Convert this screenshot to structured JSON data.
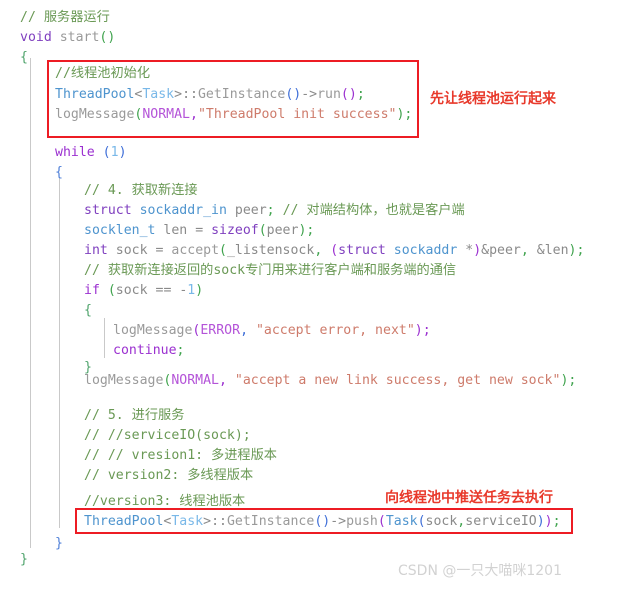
{
  "editor": {
    "language": "cpp",
    "background": "#ffffff",
    "font_size_px": 13.2,
    "line_height_px": 20
  },
  "colors": {
    "comment": "#6A9955",
    "keyword": "#7F3FBF",
    "type": "#4E94CE",
    "string": "#CE7B6B",
    "constant": "#B454D8",
    "number": "#79B8E8",
    "plain": "#8a8a8a",
    "annotation_red": "#E8392B",
    "box_red": "#ED1C24",
    "guide": "#c9c9c9",
    "watermark": "#d2d2d2"
  },
  "code": {
    "lines": [
      {
        "n": 1,
        "indent": 0,
        "text": "// 服务器运行"
      },
      {
        "n": 2,
        "indent": 0,
        "text": "void start()"
      },
      {
        "n": 3,
        "indent": 0,
        "text": "{"
      },
      {
        "n": 4,
        "indent": 1,
        "text": "//线程池初始化"
      },
      {
        "n": 5,
        "indent": 1,
        "text": "ThreadPool<Task>::GetInstance()->run();"
      },
      {
        "n": 6,
        "indent": 1,
        "text": "logMessage(NORMAL,\"ThreadPool init success\");"
      },
      {
        "n": 7,
        "indent": 1,
        "text": "while (1)"
      },
      {
        "n": 8,
        "indent": 1,
        "text": "{"
      },
      {
        "n": 9,
        "indent": 2,
        "text": "// 4. 获取新连接"
      },
      {
        "n": 10,
        "indent": 2,
        "text": "struct sockaddr_in peer; // 对端结构体，也就是客户端"
      },
      {
        "n": 11,
        "indent": 2,
        "text": "socklen_t len = sizeof(peer);"
      },
      {
        "n": 12,
        "indent": 2,
        "text": "int sock = accept(_listensock, (struct sockaddr *)&peer, &len);"
      },
      {
        "n": 13,
        "indent": 2,
        "text": "// 获取新连接返回的sock专门用来进行客户端和服务端的通信"
      },
      {
        "n": 14,
        "indent": 2,
        "text": "if (sock == -1)"
      },
      {
        "n": 15,
        "indent": 2,
        "text": "{"
      },
      {
        "n": 16,
        "indent": 3,
        "text": "logMessage(ERROR, \"accept error, next\");"
      },
      {
        "n": 17,
        "indent": 3,
        "text": "continue;"
      },
      {
        "n": 18,
        "indent": 2,
        "text": "}"
      },
      {
        "n": 19,
        "indent": 2,
        "text": "logMessage(NORMAL, \"accept a new link success, get new sock\");"
      },
      {
        "n": 20,
        "indent": 2,
        "text": "// 5. 进行服务"
      },
      {
        "n": 21,
        "indent": 2,
        "text": "// //serviceIO(sock);"
      },
      {
        "n": 22,
        "indent": 2,
        "text": "// // vresion1: 多进程版本"
      },
      {
        "n": 23,
        "indent": 2,
        "text": "// version2: 多线程版本"
      },
      {
        "n": 24,
        "indent": 2,
        "text": "//version3: 线程池版本"
      },
      {
        "n": 25,
        "indent": 2,
        "text": "ThreadPool<Task>::GetInstance()->push(Task(sock,serviceIO));"
      },
      {
        "n": 26,
        "indent": 1,
        "text": "}"
      },
      {
        "n": 27,
        "indent": 0,
        "text": "}"
      }
    ]
  },
  "annotations": [
    {
      "id": "annot-threadpool-init",
      "text": "先让线程池运行起来",
      "color": "#E8392B",
      "target_lines": [
        4,
        5,
        6
      ]
    },
    {
      "id": "annot-threadpool-push",
      "text": "向线程池中推送任务去执行",
      "color": "#E8392B",
      "target_lines": [
        25
      ]
    }
  ],
  "highlight_boxes": [
    {
      "id": "box-threadpool-init",
      "label": "线程池初始化代码块",
      "covers": "lines 4-6"
    },
    {
      "id": "box-threadpool-push",
      "label": "线程池推送任务代码行",
      "covers": "line 25"
    }
  ],
  "watermark": {
    "text": "CSDN @一只大喵咪1201"
  }
}
